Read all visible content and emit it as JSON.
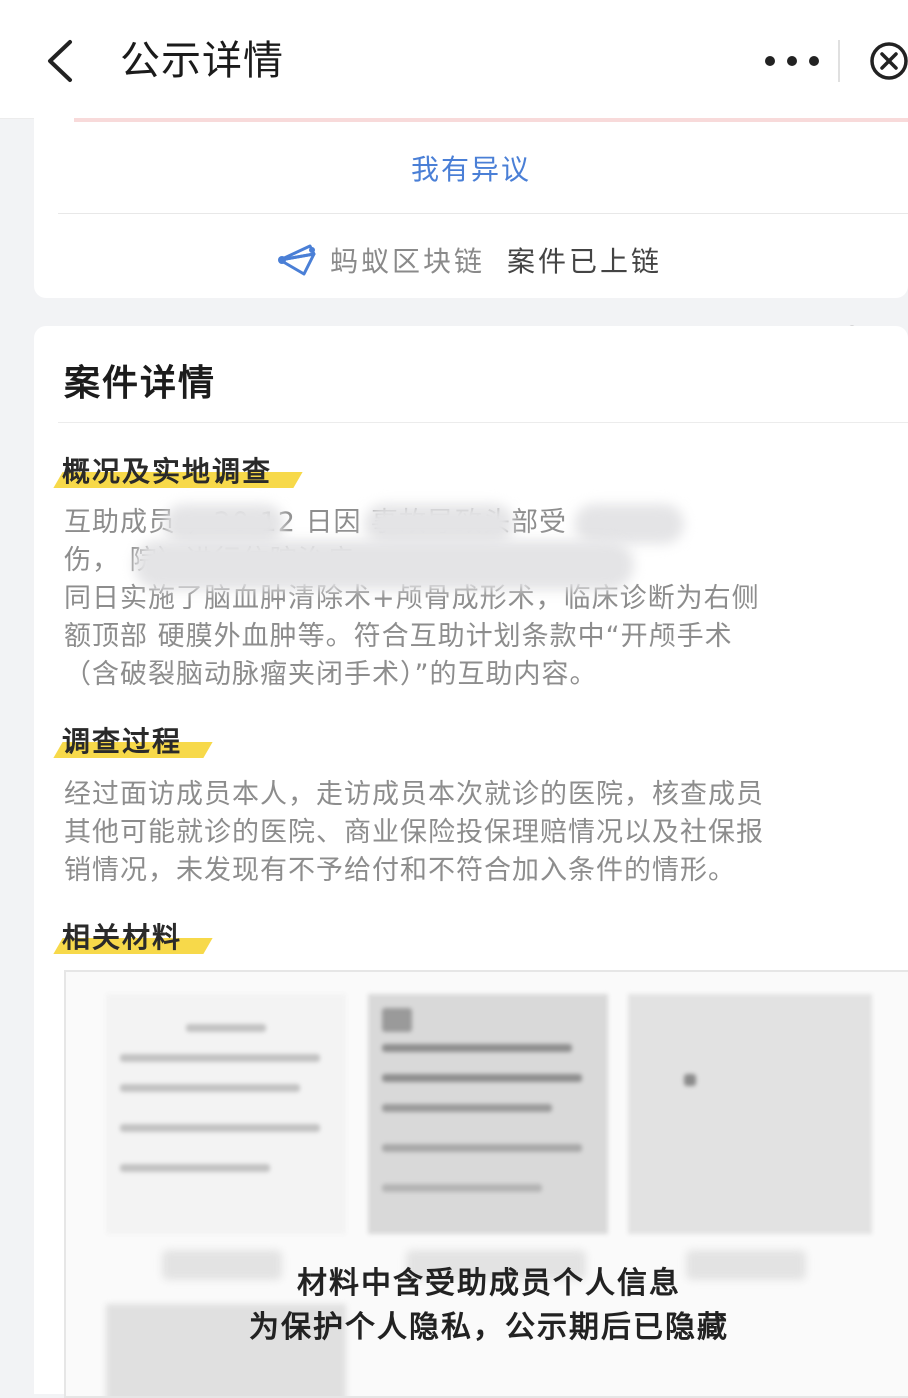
{
  "header": {
    "title": "公示详情",
    "back_icon": "chevron-left-icon",
    "more_icon": "more-horizontal-icon",
    "close_icon": "close-circle-icon"
  },
  "top_card": {
    "objection_label": "我有异议",
    "chain_brand": "蚂蚁区块链",
    "chain_status": "案件已上链"
  },
  "case_details": {
    "title": "案件详情",
    "sections": [
      {
        "heading": "概况及实地调查",
        "lines": [
          "互助成员                ，20          12            日因             事故导致头部受",
          "伤，                                                             院）进行住院治疗，",
          "同日实施了脑血肿清除术+颅骨成形术，临床诊断为右侧",
          "额顶部 硬膜外血肿等。符合互助计划条款中“开颅手术",
          "（含破裂脑动脉瘤夹闭手术）”的互助内容。"
        ]
      },
      {
        "heading": "调查过程",
        "lines": [
          "经过面访成员本人，走访成员本次就诊的医院，核查成员",
          "其他可能就诊的医院、商业保险投保理赔情况以及社保报",
          "销情况，未发现有不予给付和不符合加入条件的情形。"
        ]
      },
      {
        "heading": "相关材料",
        "lines": []
      }
    ],
    "materials_notice": [
      "材料中含受助成员个人信息",
      "为保护个人隐私，公示期后已隐藏"
    ]
  },
  "colors": {
    "link_blue": "#4a7fd6",
    "highlight_yellow": "#f7d94a",
    "body_text": "#8d8d8d"
  }
}
